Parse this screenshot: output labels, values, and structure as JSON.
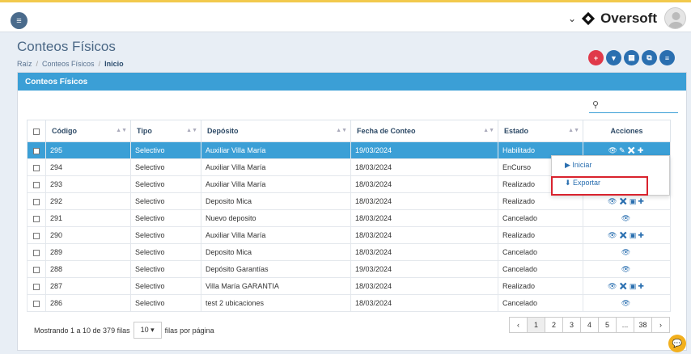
{
  "header": {
    "brand": "Oversoft"
  },
  "page": {
    "title": "Conteos Físicos"
  },
  "breadcrumb": [
    "Raíz",
    "Conteos Físicos",
    "Inicio"
  ],
  "panel": {
    "title": "Conteos Físicos"
  },
  "table": {
    "columns": [
      "Código",
      "Tipo",
      "Depósito",
      "Fecha de Conteo",
      "Estado",
      "Acciones"
    ],
    "rows": [
      {
        "codigo": "295",
        "tipo": "Selectivo",
        "deposito": "Auxiliar Villa María",
        "fecha": "19/03/2024",
        "estado": "Habilitado",
        "acciones": "👁✎✖✚"
      },
      {
        "codigo": "294",
        "tipo": "Selectivo",
        "deposito": "Auxiliar Villa María",
        "fecha": "18/03/2024",
        "estado": "EnCurso",
        "acciones": ""
      },
      {
        "codigo": "293",
        "tipo": "Selectivo",
        "deposito": "Auxiliar Villa María",
        "fecha": "18/03/2024",
        "estado": "Realizado",
        "acciones": ""
      },
      {
        "codigo": "292",
        "tipo": "Selectivo",
        "deposito": "Deposito Mica",
        "fecha": "18/03/2024",
        "estado": "Realizado",
        "acciones": "👁✖▣✚"
      },
      {
        "codigo": "291",
        "tipo": "Selectivo",
        "deposito": "Nuevo deposito",
        "fecha": "18/03/2024",
        "estado": "Cancelado",
        "acciones": "👁"
      },
      {
        "codigo": "290",
        "tipo": "Selectivo",
        "deposito": "Auxiliar Villa María",
        "fecha": "18/03/2024",
        "estado": "Realizado",
        "acciones": "👁✖▣✚"
      },
      {
        "codigo": "289",
        "tipo": "Selectivo",
        "deposito": "Deposito Mica",
        "fecha": "18/03/2024",
        "estado": "Cancelado",
        "acciones": "👁"
      },
      {
        "codigo": "288",
        "tipo": "Selectivo",
        "deposito": "Depósito Garantías",
        "fecha": "19/03/2024",
        "estado": "Cancelado",
        "acciones": "👁"
      },
      {
        "codigo": "287",
        "tipo": "Selectivo",
        "deposito": "Villa María GARANTIA",
        "fecha": "18/03/2024",
        "estado": "Realizado",
        "acciones": "👁✖▣✚"
      },
      {
        "codigo": "286",
        "tipo": "Selectivo",
        "deposito": "test 2 ubicaciones",
        "fecha": "18/03/2024",
        "estado": "Cancelado",
        "acciones": "👁"
      }
    ]
  },
  "dropdown": {
    "items": [
      "▶ Iniciar",
      "⬇ Exportar"
    ]
  },
  "footer": {
    "showing": "Mostrando 1 a 10 de 379 filas",
    "page_size": "10 ▾",
    "rows_per_page": "filas por página"
  },
  "pager": [
    "‹",
    "1",
    "2",
    "3",
    "4",
    "5",
    "...",
    "38",
    "›"
  ],
  "colors": {
    "accent": "#3b9fd6",
    "highlight": "#d9232e",
    "add": "#e0394a"
  }
}
